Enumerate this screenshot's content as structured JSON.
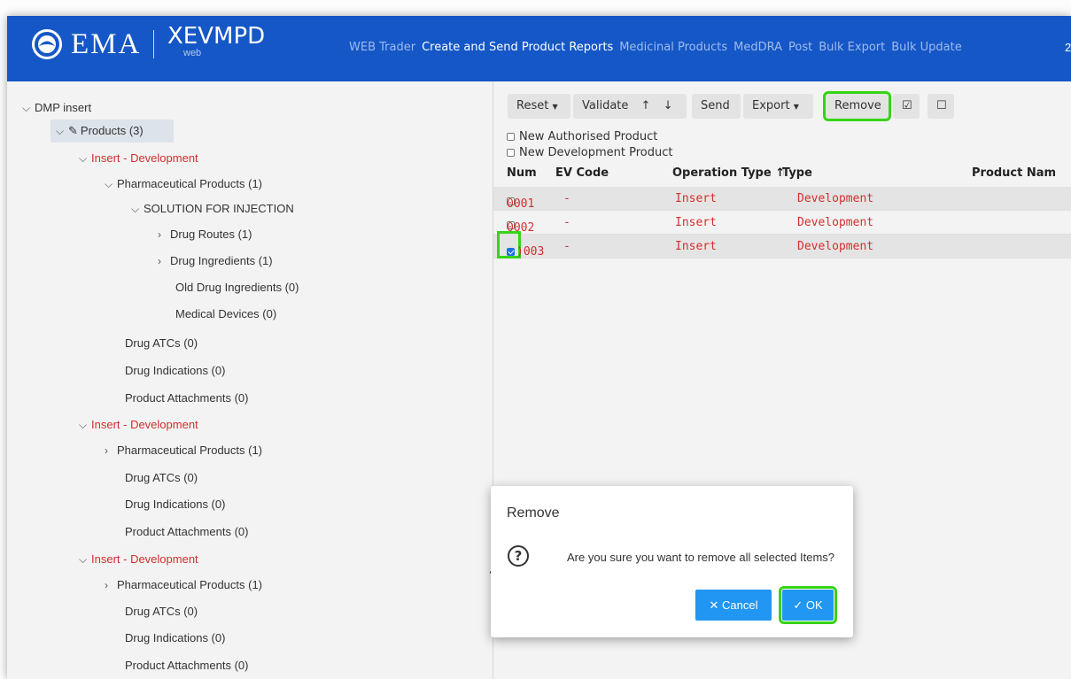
{
  "header": {
    "logo_text": "EMA",
    "app_name": "XEVMPD",
    "app_sub": "web",
    "nav": [
      {
        "label": "WEB Trader",
        "active": false
      },
      {
        "label": "Create and Send Product Reports",
        "active": true
      },
      {
        "label": "Medicinal Products",
        "active": false
      },
      {
        "label": "MedDRA",
        "active": false
      },
      {
        "label": "Post",
        "active": false
      },
      {
        "label": "Bulk Export",
        "active": false
      },
      {
        "label": "Bulk Update",
        "active": false
      }
    ],
    "nav_more": "2"
  },
  "tree": {
    "root": "DMP insert",
    "products": "Products (3)",
    "groups": [
      {
        "label": "Insert - Development",
        "pharma": "Pharmaceutical Products (1)",
        "dosage_form": "SOLUTION FOR INJECTION",
        "routes": "Drug Routes (1)",
        "ingredients": "Drug Ingredients (1)",
        "old_ingredients": "Old Drug Ingredients (0)",
        "devices": "Medical Devices (0)",
        "atcs": "Drug ATCs (0)",
        "indications": "Drug Indications (0)",
        "attachments": "Product Attachments (0)"
      },
      {
        "label": "Insert - Development",
        "pharma": "Pharmaceutical Products (1)",
        "atcs": "Drug ATCs (0)",
        "indications": "Drug Indications (0)",
        "attachments": "Product Attachments (0)"
      },
      {
        "label": "Insert - Development",
        "pharma": "Pharmaceutical Products (1)",
        "atcs": "Drug ATCs (0)",
        "indications": "Drug Indications (0)",
        "attachments": "Product Attachments (0)"
      }
    ]
  },
  "toolbar": {
    "reset": "Reset",
    "validate": "Validate",
    "up": "↑",
    "down": "↓",
    "send": "Send",
    "export": "Export",
    "remove": "Remove",
    "check_all": "☑",
    "uncheck_all": "☐"
  },
  "new_products": {
    "authorised": "New Authorised Product",
    "development": "New Development Product"
  },
  "table": {
    "headers": {
      "num": "Num",
      "ev_code": "EV Code",
      "operation_type": "Operation Type ↑",
      "type": "Type",
      "product_name": "Product Nam"
    },
    "rows": [
      {
        "num": "0001",
        "ev_code": "-",
        "operation": "Insert",
        "type": "Development",
        "checked": false
      },
      {
        "num": "0002",
        "ev_code": "-",
        "operation": "Insert",
        "type": "Development",
        "checked": false
      },
      {
        "num": "0003",
        "ev_code": "-",
        "operation": "Insert",
        "type": "Development",
        "checked": true
      }
    ],
    "row3_visible_num": ")003"
  },
  "dialog": {
    "title": "Remove",
    "message": "Are you sure you want to remove all selected Items?",
    "cancel": "Cancel",
    "ok": "OK",
    "question_glyph": "?"
  }
}
